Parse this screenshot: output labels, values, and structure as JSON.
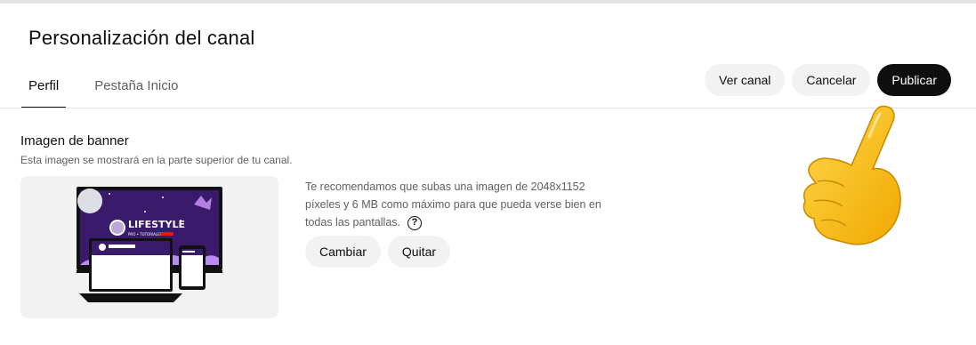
{
  "page": {
    "title": "Personalización del canal"
  },
  "tabs": [
    {
      "label": "Perfil",
      "active": true
    },
    {
      "label": "Pestaña Inicio",
      "active": false
    }
  ],
  "actions": {
    "view_channel": "Ver canal",
    "cancel": "Cancelar",
    "publish": "Publicar"
  },
  "banner_section": {
    "title": "Imagen de banner",
    "description": "Esta imagen se mostrará en la parte superior de tu canal.",
    "recommendation": "Te recomendamos que subas una imagen de 2048x1152 píxeles y 6 MB como máximo para que pueda verse bien en todas las pantallas.",
    "help_icon": "question-circle-icon",
    "help_glyph": "?",
    "change_label": "Cambiar",
    "remove_label": "Quitar",
    "preview": {
      "banner_text": "LIFESTYLE",
      "banner_subtext": "PRO • TUTORIALES"
    }
  },
  "overlay": {
    "icon": "pointing-hand-icon",
    "color": "#f7c325"
  },
  "colors": {
    "primary_button": "#0f0f0f",
    "secondary_button": "#f2f2f2",
    "banner_purple": "#3a1a6b",
    "banner_accent": "#c08cf0"
  }
}
